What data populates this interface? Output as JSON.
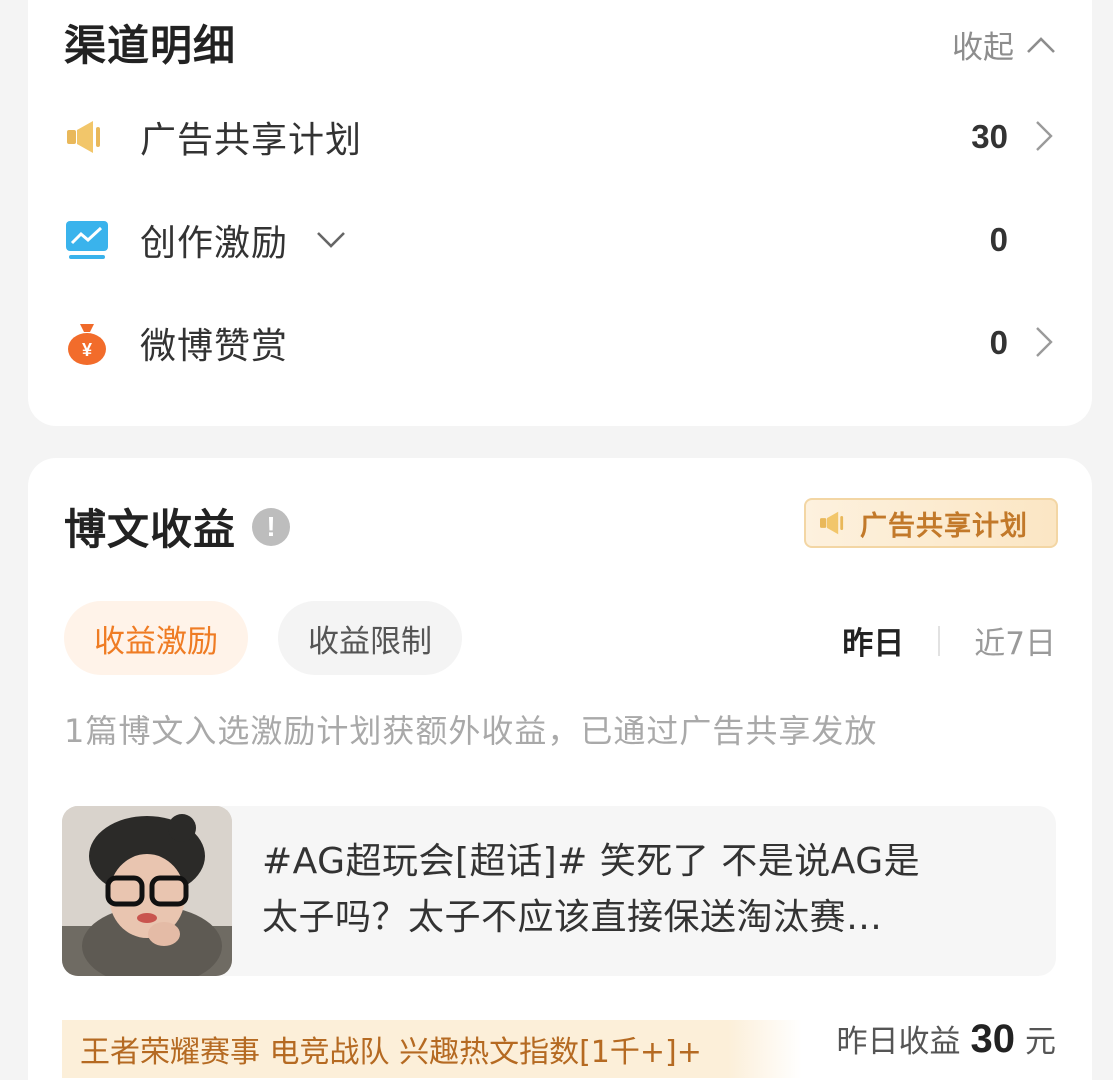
{
  "channels": {
    "title": "渠道明细",
    "collapse_label": "收起",
    "items": [
      {
        "label": "广告共享计划",
        "value": "30",
        "icon": "megaphone-icon",
        "has_arrow": true,
        "has_dropdown": false
      },
      {
        "label": "创作激励",
        "value": "0",
        "icon": "chart-monitor-icon",
        "has_arrow": false,
        "has_dropdown": true
      },
      {
        "label": "微博赞赏",
        "value": "0",
        "icon": "money-bag-icon",
        "has_arrow": true,
        "has_dropdown": false
      }
    ]
  },
  "earnings": {
    "title": "博文收益",
    "badge_label": "广告共享计划",
    "tabs": [
      {
        "label": "收益激励",
        "active": true
      },
      {
        "label": "收益限制",
        "active": false
      }
    ],
    "periods": [
      {
        "label": "昨日",
        "active": true
      },
      {
        "label": "近7日",
        "active": false
      }
    ],
    "description": "1篇博文入选激励计划获额外收益，已通过广告共享发放",
    "post": {
      "line1": "#AG超玩会[超话]# 笑死了 不是说AG是",
      "line2": "太子吗？太子不应该直接保送淘汰赛…"
    },
    "tags": "王者荣耀赛事 电竞战队 兴趣热文指数[1千+]+",
    "yesterday_label": "昨日收益",
    "yesterday_value": "30",
    "yesterday_unit": "元"
  },
  "colors": {
    "accent_orange": "#ef7c24",
    "badge_text": "#c2792a",
    "muted_text": "#a9a9a9"
  }
}
